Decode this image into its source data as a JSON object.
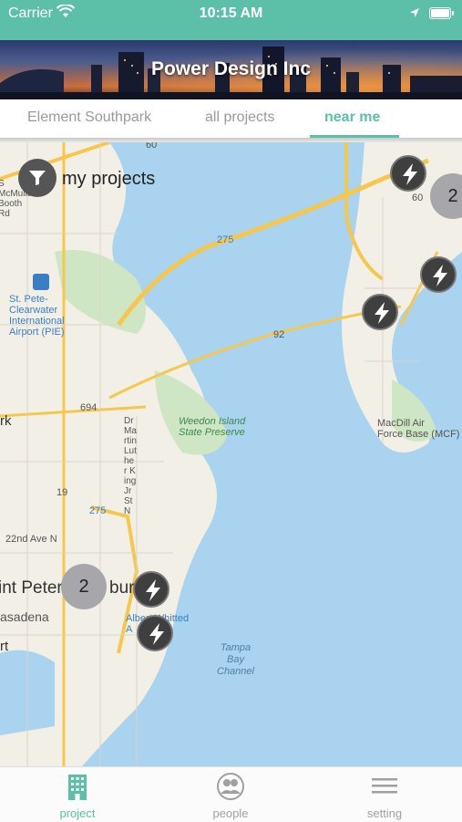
{
  "status_bar": {
    "carrier": "Carrier",
    "time": "10:15 AM"
  },
  "header": {
    "title": "Power Design Inc"
  },
  "tabs": [
    {
      "label": "Element Southpark",
      "active": false
    },
    {
      "label": "all projects",
      "active": false
    },
    {
      "label": "near me",
      "active": true
    }
  ],
  "filter": {
    "label": "my projects",
    "icon": "filter-icon"
  },
  "map": {
    "labels": {
      "road_60_top": "60",
      "road_60_right": "60",
      "mcmullen": "S McMullen Booth Rd",
      "i275_a": "275",
      "i275_b": "275",
      "road_92": "92",
      "road_694": "694",
      "road_19": "19",
      "airport_pie": "St. Pete-\nClearwater\nInternational\nAirport (PIE)",
      "weedon": "Weedon Island\nState Preserve",
      "martin": "Dr Martin Luther King Jr St N",
      "macdill": "MacDill Air\nForce Base (MCF)",
      "ave22": "22nd Ave N",
      "st_pete": "int Peters",
      "burg": "burg",
      "pasadena": "asadena",
      "albert": "Albert Whitted\nA    (SPG)",
      "tampa_bay": "Tampa\nBay\nChannel",
      "park": "rk",
      "rt": "rt"
    },
    "clusters": [
      {
        "count": "2"
      },
      {
        "count": "2"
      }
    ],
    "pin_icon": "lightning-bolt-icon"
  },
  "bottom_tabs": [
    {
      "label": "project",
      "icon": "building-icon",
      "active": true
    },
    {
      "label": "people",
      "icon": "people-icon",
      "active": false
    },
    {
      "label": "setting",
      "icon": "menu-icon",
      "active": false
    }
  ],
  "colors": {
    "accent": "#5cc0a8",
    "map_water": "#a9d3ee",
    "map_land": "#f2efe7",
    "pin": "#3f3f3f",
    "cluster": "#a6a6ab"
  }
}
